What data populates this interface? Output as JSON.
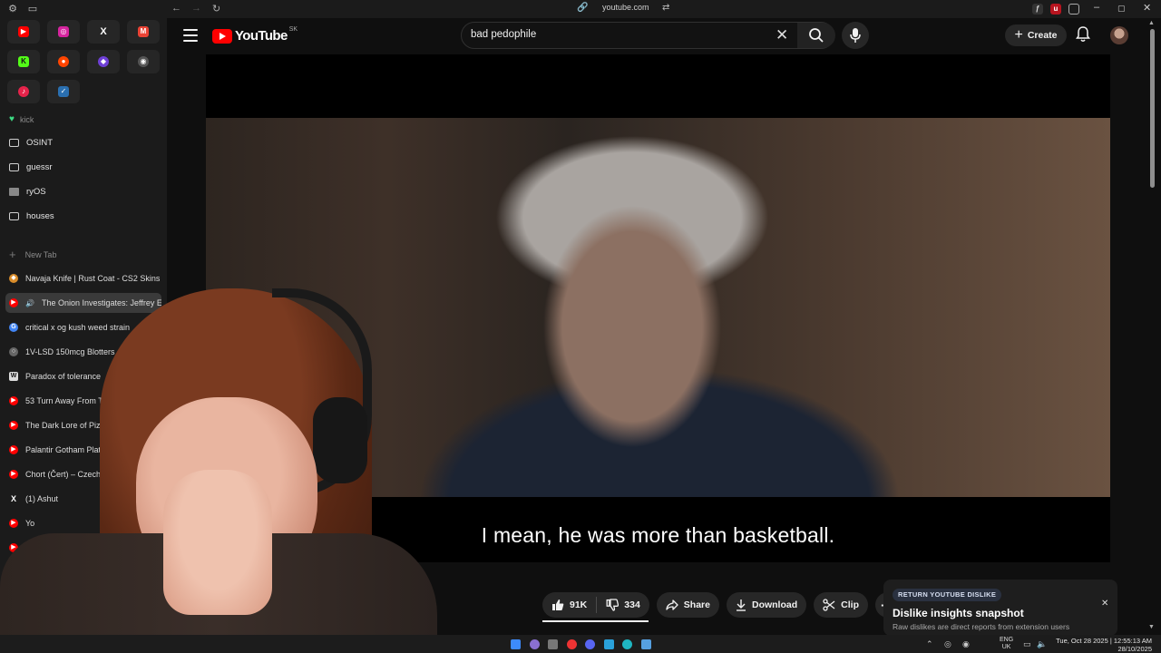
{
  "browser": {
    "url": "youtube.com",
    "sidebar": {
      "pinned": [
        {
          "icon": "youtube-icon",
          "color": "#ff0000"
        },
        {
          "icon": "instagram-icon",
          "color": "#d6249f"
        },
        {
          "icon": "x-icon",
          "color": "#000000"
        },
        {
          "icon": "gmail-icon",
          "color": "#ea4335"
        },
        {
          "icon": "kick-icon",
          "color": "#53fc18"
        },
        {
          "icon": "reddit-icon",
          "color": "#ff4500"
        },
        {
          "icon": "app-icon",
          "color": "#6e3fd6"
        },
        {
          "icon": "circle-app-icon",
          "color": "#555555"
        },
        {
          "icon": "music-icon",
          "color": "#e5234a"
        },
        {
          "icon": "steam-icon",
          "color": "#1b2838"
        }
      ],
      "kick_label": "kick",
      "folders": [
        "OSINT",
        "guessr",
        "ryOS",
        "houses"
      ],
      "new_tab_label": "New Tab",
      "tabs": [
        "Navaja Knife | Rust Coat - CS2 Skins",
        "The Onion Investigates: Jeffrey E...",
        "critical x og kush weed strain",
        "1V-LSD 150mcg Blotters - Chemic",
        "Paradox of tolerance",
        "53 Turn Away From Them. I",
        "The Dark Lore of Pizza",
        "Palantir Gotham Platform for",
        "Chort (Čert) – Czech and",
        "(1) Ashut",
        "Yo",
        ""
      ],
      "footer_letter": "M"
    }
  },
  "youtube": {
    "logo_text": "YouTube",
    "country_code": "SK",
    "search": {
      "value": "bad pedophile"
    },
    "create_label": "Create",
    "subtitle": "I mean, he was more than basketball.",
    "actions": {
      "likes": "91K",
      "dislikes": "334",
      "share": "Share",
      "download": "Download",
      "clip": "Clip",
      "like_ratio": 0.996
    },
    "dislike_card": {
      "badge": "RETURN YOUTUBE DISLIKE",
      "title": "Dislike insights snapshot",
      "subtitle": "Raw dislikes are direct reports from extension users"
    }
  },
  "taskbar": {
    "lang_line1": "ENG",
    "lang_line2": "UK",
    "time_line1": "Tue, Oct 28 2025 | 12:55:13 AM",
    "time_line2": "28/10/2025"
  }
}
